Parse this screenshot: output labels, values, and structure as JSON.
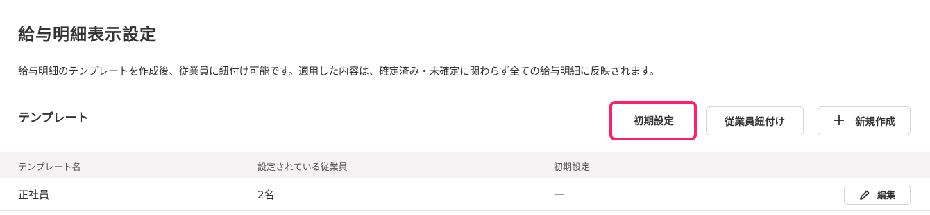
{
  "page": {
    "title": "給与明細表示設定",
    "description": "給与明細のテンプレートを作成後、従業員に紐付け可能です。適用した内容は、確定済み・未確定に関わらず全ての給与明細に反映されます。"
  },
  "section": {
    "title": "テンプレート"
  },
  "toolbar": {
    "initial_settings_label": "初期設定",
    "link_employees_label": "従業員紐付け",
    "new_create_label": "新規作成",
    "new_create_icon": "plus-icon",
    "highlight_color": "#ff1f6f"
  },
  "table": {
    "columns": [
      "テンプレート名",
      "設定されている従業員",
      "初期設定"
    ],
    "rows": [
      {
        "name": "正社員",
        "employees": "2名",
        "initial": "—",
        "edit_label": "編集",
        "edit_icon": "pencil-icon"
      }
    ]
  }
}
